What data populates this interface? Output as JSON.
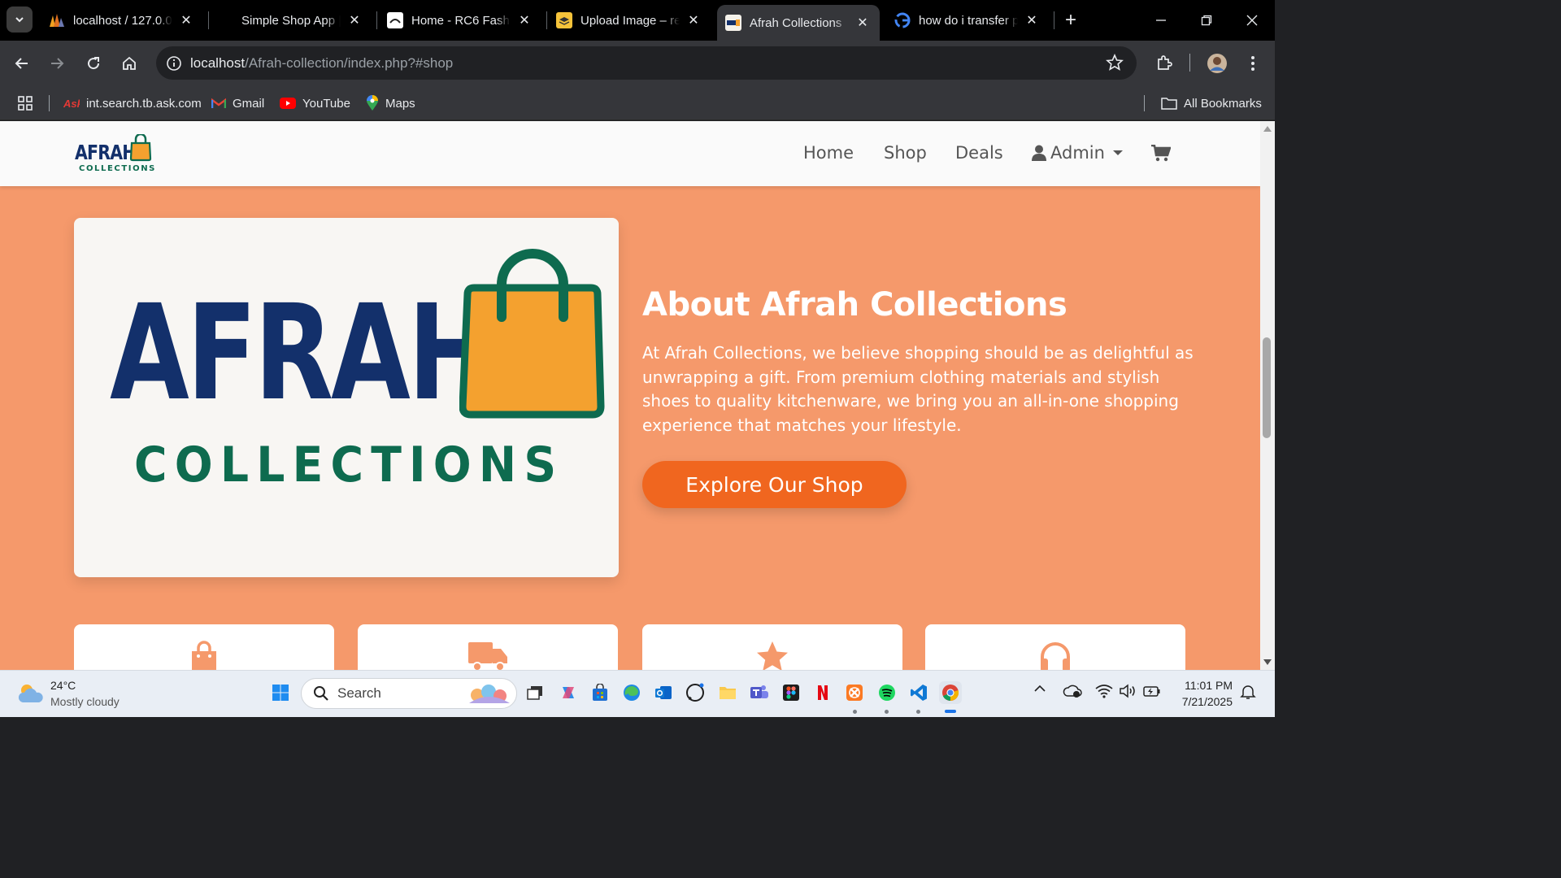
{
  "tabs": [
    {
      "title": "localhost / 127.0.0.",
      "favicon": "phpmyadmin-icon"
    },
    {
      "title": "Simple Shop App |",
      "favicon": "none"
    },
    {
      "title": "Home - RC6 Fashion",
      "favicon": "site-icon"
    },
    {
      "title": "Upload Image – re",
      "favicon": "layers-icon"
    },
    {
      "title": "Afrah Collections",
      "favicon": "afrah-icon",
      "active": true
    },
    {
      "title": "how do i transfer p",
      "favicon": "google-icon"
    }
  ],
  "address_bar": {
    "host": "localhost",
    "path": "/Afrah-collection/index.php?#shop"
  },
  "bookmarks": [
    {
      "label": "int.search.tb.ask.com"
    },
    {
      "label": "Gmail"
    },
    {
      "label": "YouTube"
    },
    {
      "label": "Maps"
    }
  ],
  "all_bookmarks_label": "All Bookmarks",
  "site": {
    "brand_main": "AFRAH",
    "brand_sub": "COLLECTIONS",
    "nav": {
      "home": "Home",
      "shop": "Shop",
      "deals": "Deals",
      "admin": "Admin"
    },
    "hero_logo_main": "AFRAH",
    "hero_logo_sub": "COLLECTIONS",
    "about_title": "About Afrah Collections",
    "about_text": "At Afrah Collections, we believe shopping should be as delightful as unwrapping a gift. From premium clothing materials and stylish shoes to quality kitchenware, we bring you an all-in-one shopping experience that matches your lifestyle.",
    "cta_label": "Explore Our Shop",
    "feature_icons": [
      "shopping-bag-icon",
      "truck-icon",
      "star-icon",
      "headset-icon"
    ],
    "colors": {
      "page_bg": "#f5996b",
      "navy": "#13306b",
      "green": "#0e6b4f",
      "orange": "#f0661f",
      "bag": "#f4a12f"
    }
  },
  "taskbar": {
    "weather_temp": "24°C",
    "weather_desc": "Mostly cloudy",
    "search_label": "Search",
    "time": "11:01 PM",
    "date": "7/21/2025"
  }
}
